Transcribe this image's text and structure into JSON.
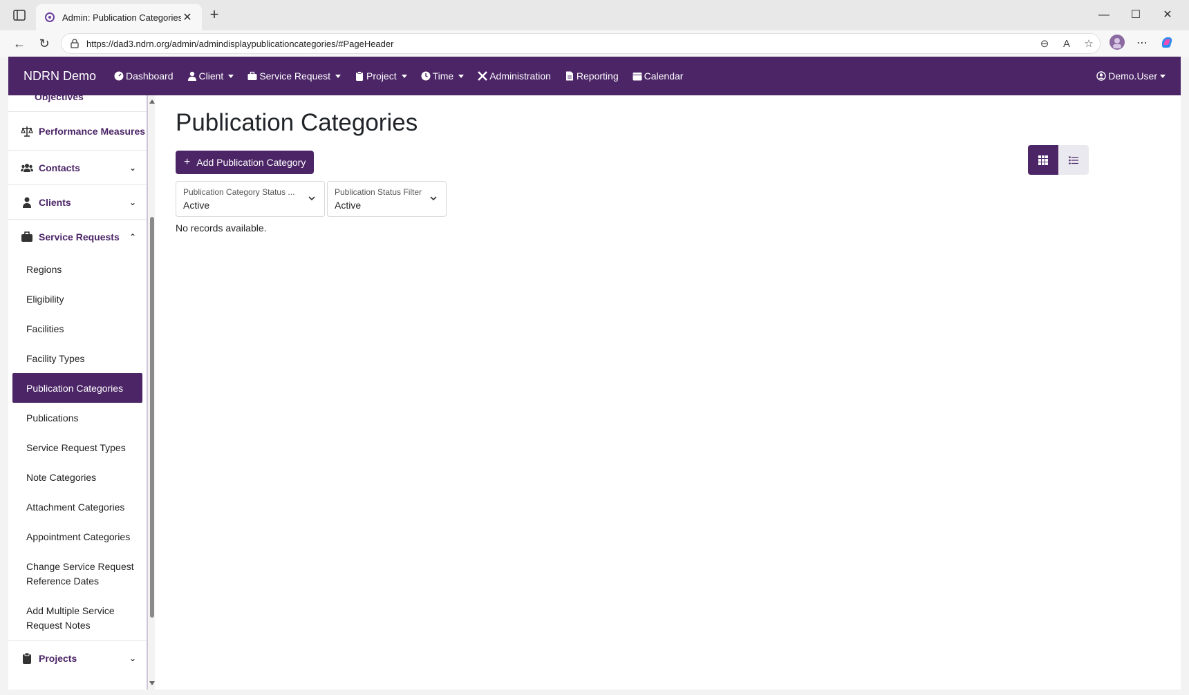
{
  "browser": {
    "tab_title": "Admin: Publication Categories",
    "url": "https://dad3.ndrn.org/admin/admindisplaypublicationcategories/#PageHeader"
  },
  "topnav": {
    "brand": "NDRN Demo",
    "items": [
      {
        "label": "Dashboard",
        "icon": "dashboard-icon",
        "dropdown": false
      },
      {
        "label": "Client",
        "icon": "user-icon",
        "dropdown": true
      },
      {
        "label": "Service Request",
        "icon": "briefcase-icon",
        "dropdown": true
      },
      {
        "label": "Project",
        "icon": "clipboard-icon",
        "dropdown": true
      },
      {
        "label": "Time",
        "icon": "clock-icon",
        "dropdown": true
      },
      {
        "label": "Administration",
        "icon": "tools-icon",
        "dropdown": false
      },
      {
        "label": "Reporting",
        "icon": "file-icon",
        "dropdown": false
      },
      {
        "label": "Calendar",
        "icon": "calendar-icon",
        "dropdown": false
      }
    ],
    "user": "Demo.User"
  },
  "sidebar": {
    "objectives": "Objectives",
    "performance_measures": "Performance Measures",
    "contacts": "Contacts",
    "clients": "Clients",
    "service_requests": "Service Requests",
    "sub_items": [
      "Regions",
      "Eligibility",
      "Facilities",
      "Facility Types",
      "Publication Categories",
      "Publications",
      "Service Request Types",
      "Note Categories",
      "Attachment Categories",
      "Appointment Categories",
      "Change Service Request Reference Dates",
      "Add Multiple Service Request Notes"
    ],
    "projects": "Projects"
  },
  "main": {
    "title": "Publication Categories",
    "add_button": "Add Publication Category",
    "filters": [
      {
        "label": "Publication Category Status ...",
        "value": "Active"
      },
      {
        "label": "Publication Status Filter",
        "value": "Active"
      }
    ],
    "empty_message": "No records available."
  },
  "colors": {
    "brand_purple": "#4b2566"
  }
}
